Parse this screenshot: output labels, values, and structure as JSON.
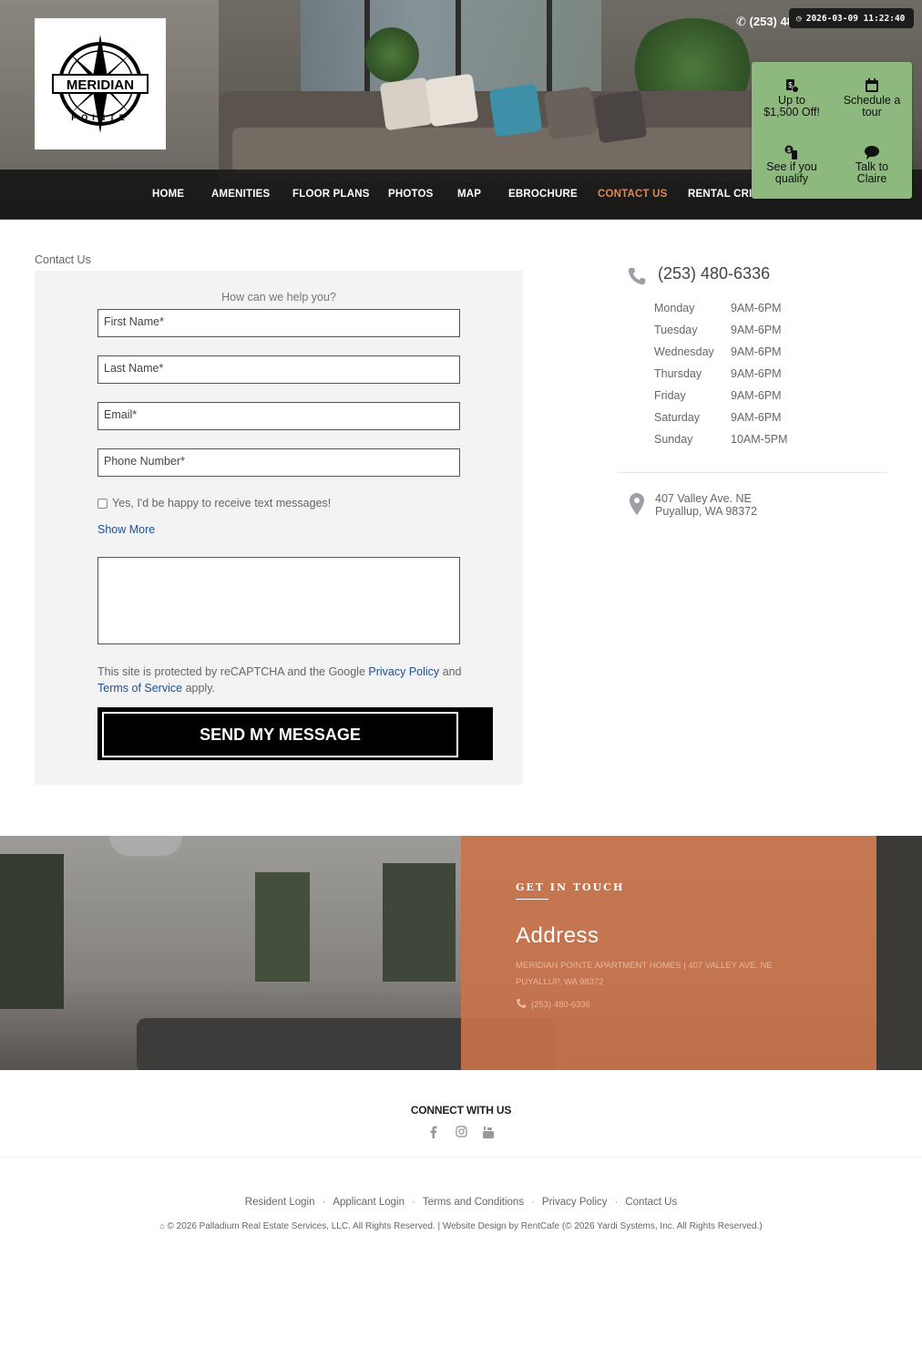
{
  "brand": {
    "logo_text": "MERIDIAN",
    "logo_sub": "POINTE"
  },
  "top": {
    "phone": "(253) 480-6336",
    "clock": "2026-03-09 11:22:40"
  },
  "nav": [
    "HOME",
    "AMENITIES",
    "FLOOR PLANS",
    "PHOTOS",
    "MAP",
    "EBROCHURE",
    "CONTACT US",
    "RENTAL CRITERIA"
  ],
  "promo": {
    "offer": "Up to $1,500 Off!",
    "tour": "Schedule a tour",
    "qualify": "See if you qualify",
    "talk": "Talk to Claire"
  },
  "breadcrumb": "Contact Us",
  "form": {
    "heading": "How can we help you?",
    "first_name": "First Name*",
    "last_name": "Last Name*",
    "email": "Email*",
    "phone": "Phone Number*",
    "sms_opt": "Yes, I'd be happy to receive text messages!",
    "show_more": "Show More",
    "captcha_prefix": "This site is protected by reCAPTCHA and the Google",
    "privacy_link": "Privacy Policy",
    "captcha_and": "and",
    "terms_link": "Terms of Service",
    "captcha_suffix": "apply.",
    "submit": "SEND MY MESSAGE"
  },
  "office": {
    "phone": "(253) 480-6336",
    "hours": [
      {
        "day": "Monday",
        "time": "9AM-6PM"
      },
      {
        "day": "Tuesday",
        "time": "9AM-6PM"
      },
      {
        "day": "Wednesday",
        "time": "9AM-6PM"
      },
      {
        "day": "Thursday",
        "time": "9AM-6PM"
      },
      {
        "day": "Friday",
        "time": "9AM-6PM"
      },
      {
        "day": "Saturday",
        "time": "9AM-6PM"
      },
      {
        "day": "Sunday",
        "time": "10AM-5PM"
      }
    ],
    "address_line1": "407 Valley Ave. NE",
    "address_line2": "Puyallup, WA 98372"
  },
  "touch": {
    "eyebrow": "GET IN TOUCH",
    "title": "Address",
    "body": "MERIDIAN POINTE APARTMENT HOMES | 407 VALLEY AVE. NE PUYALLUP, WA 98372",
    "phone": "(253) 480-6336",
    "accent": "#c47048"
  },
  "footer": {
    "connect": "CONNECT WITH US",
    "links": [
      "Resident Login",
      "Applicant Login",
      "Terms and Conditions",
      "Privacy Policy",
      "Contact Us"
    ],
    "copyright": "© 2026 Palladium Real Estate Services, LLC. All Rights Reserved. | Website Design by RentCafe (© 2026 Yardi Systems, Inc. All Rights Reserved.)"
  },
  "colors": {
    "promo_bg": "#8db87e",
    "nav_active": "#d98a5c",
    "link": "#1d4f8f"
  }
}
